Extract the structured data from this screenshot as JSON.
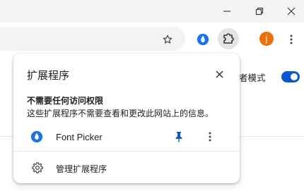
{
  "background": {
    "incognito_label": "者模式"
  },
  "popup": {
    "title": "扩展程序",
    "section_heading": "不需要任何访问权限",
    "section_description": "这些扩展程序不需要查看和更改此网站上的信息。",
    "extensions": [
      {
        "name": "Font Picker",
        "icon": "font-picker-icon"
      }
    ],
    "manage_label": "管理扩展程序"
  },
  "toolbar": {
    "avatar_letter": "j"
  },
  "colors": {
    "accent": "#0b57d0",
    "extension_icon": "#1a73e8",
    "avatar": "#e8710a",
    "titlebar": "#f4f4f4",
    "omnibox": "#f1f3f4"
  },
  "icons": {
    "window": [
      "minimize-icon",
      "restore-icon",
      "close-icon"
    ],
    "toolbar": [
      "bookmark-star-icon",
      "font-picker-icon",
      "extensions-puzzle-icon",
      "avatar",
      "kebab-menu-icon"
    ],
    "popup": [
      "close-icon",
      "pin-icon",
      "more-vertical-icon",
      "gear-icon"
    ]
  }
}
